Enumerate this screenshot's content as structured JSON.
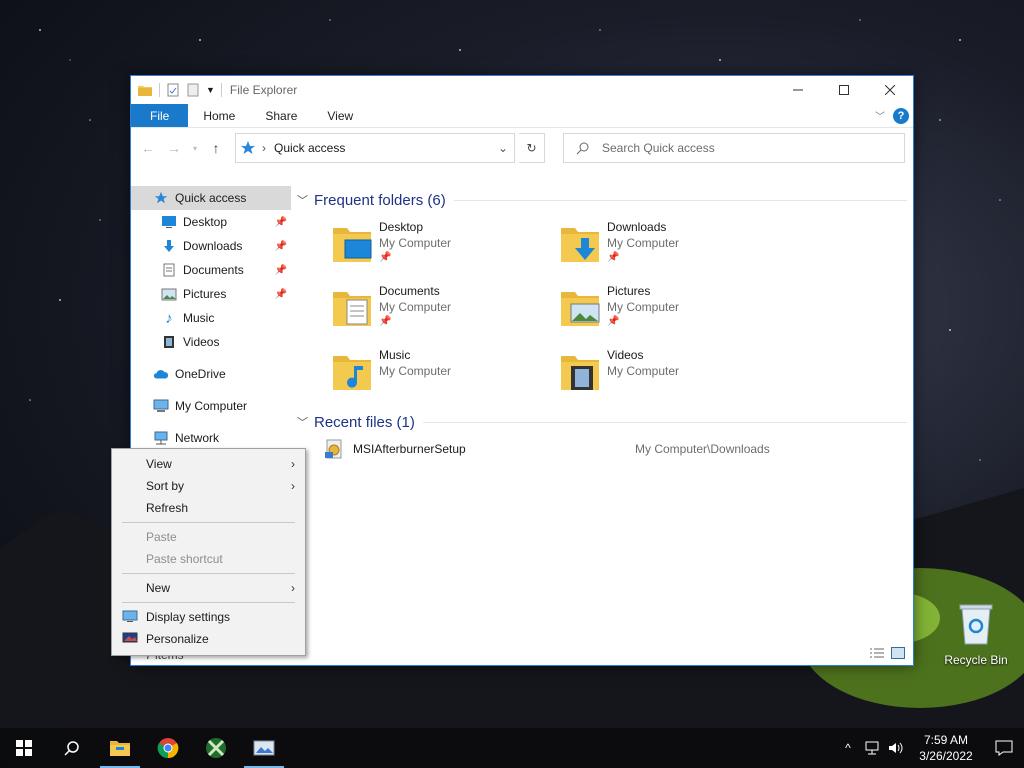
{
  "window": {
    "title": "File Explorer",
    "tabs": [
      "File",
      "Home",
      "Share",
      "View"
    ]
  },
  "address": {
    "crumb": "Quick access",
    "search_placeholder": "Search Quick access"
  },
  "nav": {
    "quick_access": "Quick access",
    "pinned": [
      {
        "label": "Desktop",
        "icon": "desktop-icon"
      },
      {
        "label": "Downloads",
        "icon": "download-icon"
      },
      {
        "label": "Documents",
        "icon": "document-icon"
      },
      {
        "label": "Pictures",
        "icon": "picture-icon"
      }
    ],
    "unpinned": [
      {
        "label": "Music",
        "icon": "music-icon"
      },
      {
        "label": "Videos",
        "icon": "video-icon"
      }
    ],
    "onedrive": "OneDrive",
    "my_computer": "My Computer",
    "network": "Network"
  },
  "frequent": {
    "header": "Frequent folders (6)",
    "items": [
      {
        "name": "Desktop",
        "location": "My Computer",
        "pinned": true
      },
      {
        "name": "Downloads",
        "location": "My Computer",
        "pinned": true
      },
      {
        "name": "Documents",
        "location": "My Computer",
        "pinned": true
      },
      {
        "name": "Pictures",
        "location": "My Computer",
        "pinned": true
      },
      {
        "name": "Music",
        "location": "My Computer",
        "pinned": false
      },
      {
        "name": "Videos",
        "location": "My Computer",
        "pinned": false
      }
    ]
  },
  "recent": {
    "header": "Recent files (1)",
    "items": [
      {
        "name": "MSIAfterburnerSetup",
        "path": "My Computer\\Downloads"
      }
    ]
  },
  "status": {
    "items_partial": "7 items"
  },
  "context_menu": {
    "view": "View",
    "sort_by": "Sort by",
    "refresh": "Refresh",
    "paste": "Paste",
    "paste_shortcut": "Paste shortcut",
    "new": "New",
    "display_settings": "Display settings",
    "personalize": "Personalize"
  },
  "desktop": {
    "recycle_bin": "Recycle Bin"
  },
  "taskbar": {
    "time": "7:59 AM",
    "date": "3/26/2022"
  },
  "colors": {
    "accent": "#1979ca",
    "group_header": "#1e3287",
    "folder": "#f4c950"
  }
}
